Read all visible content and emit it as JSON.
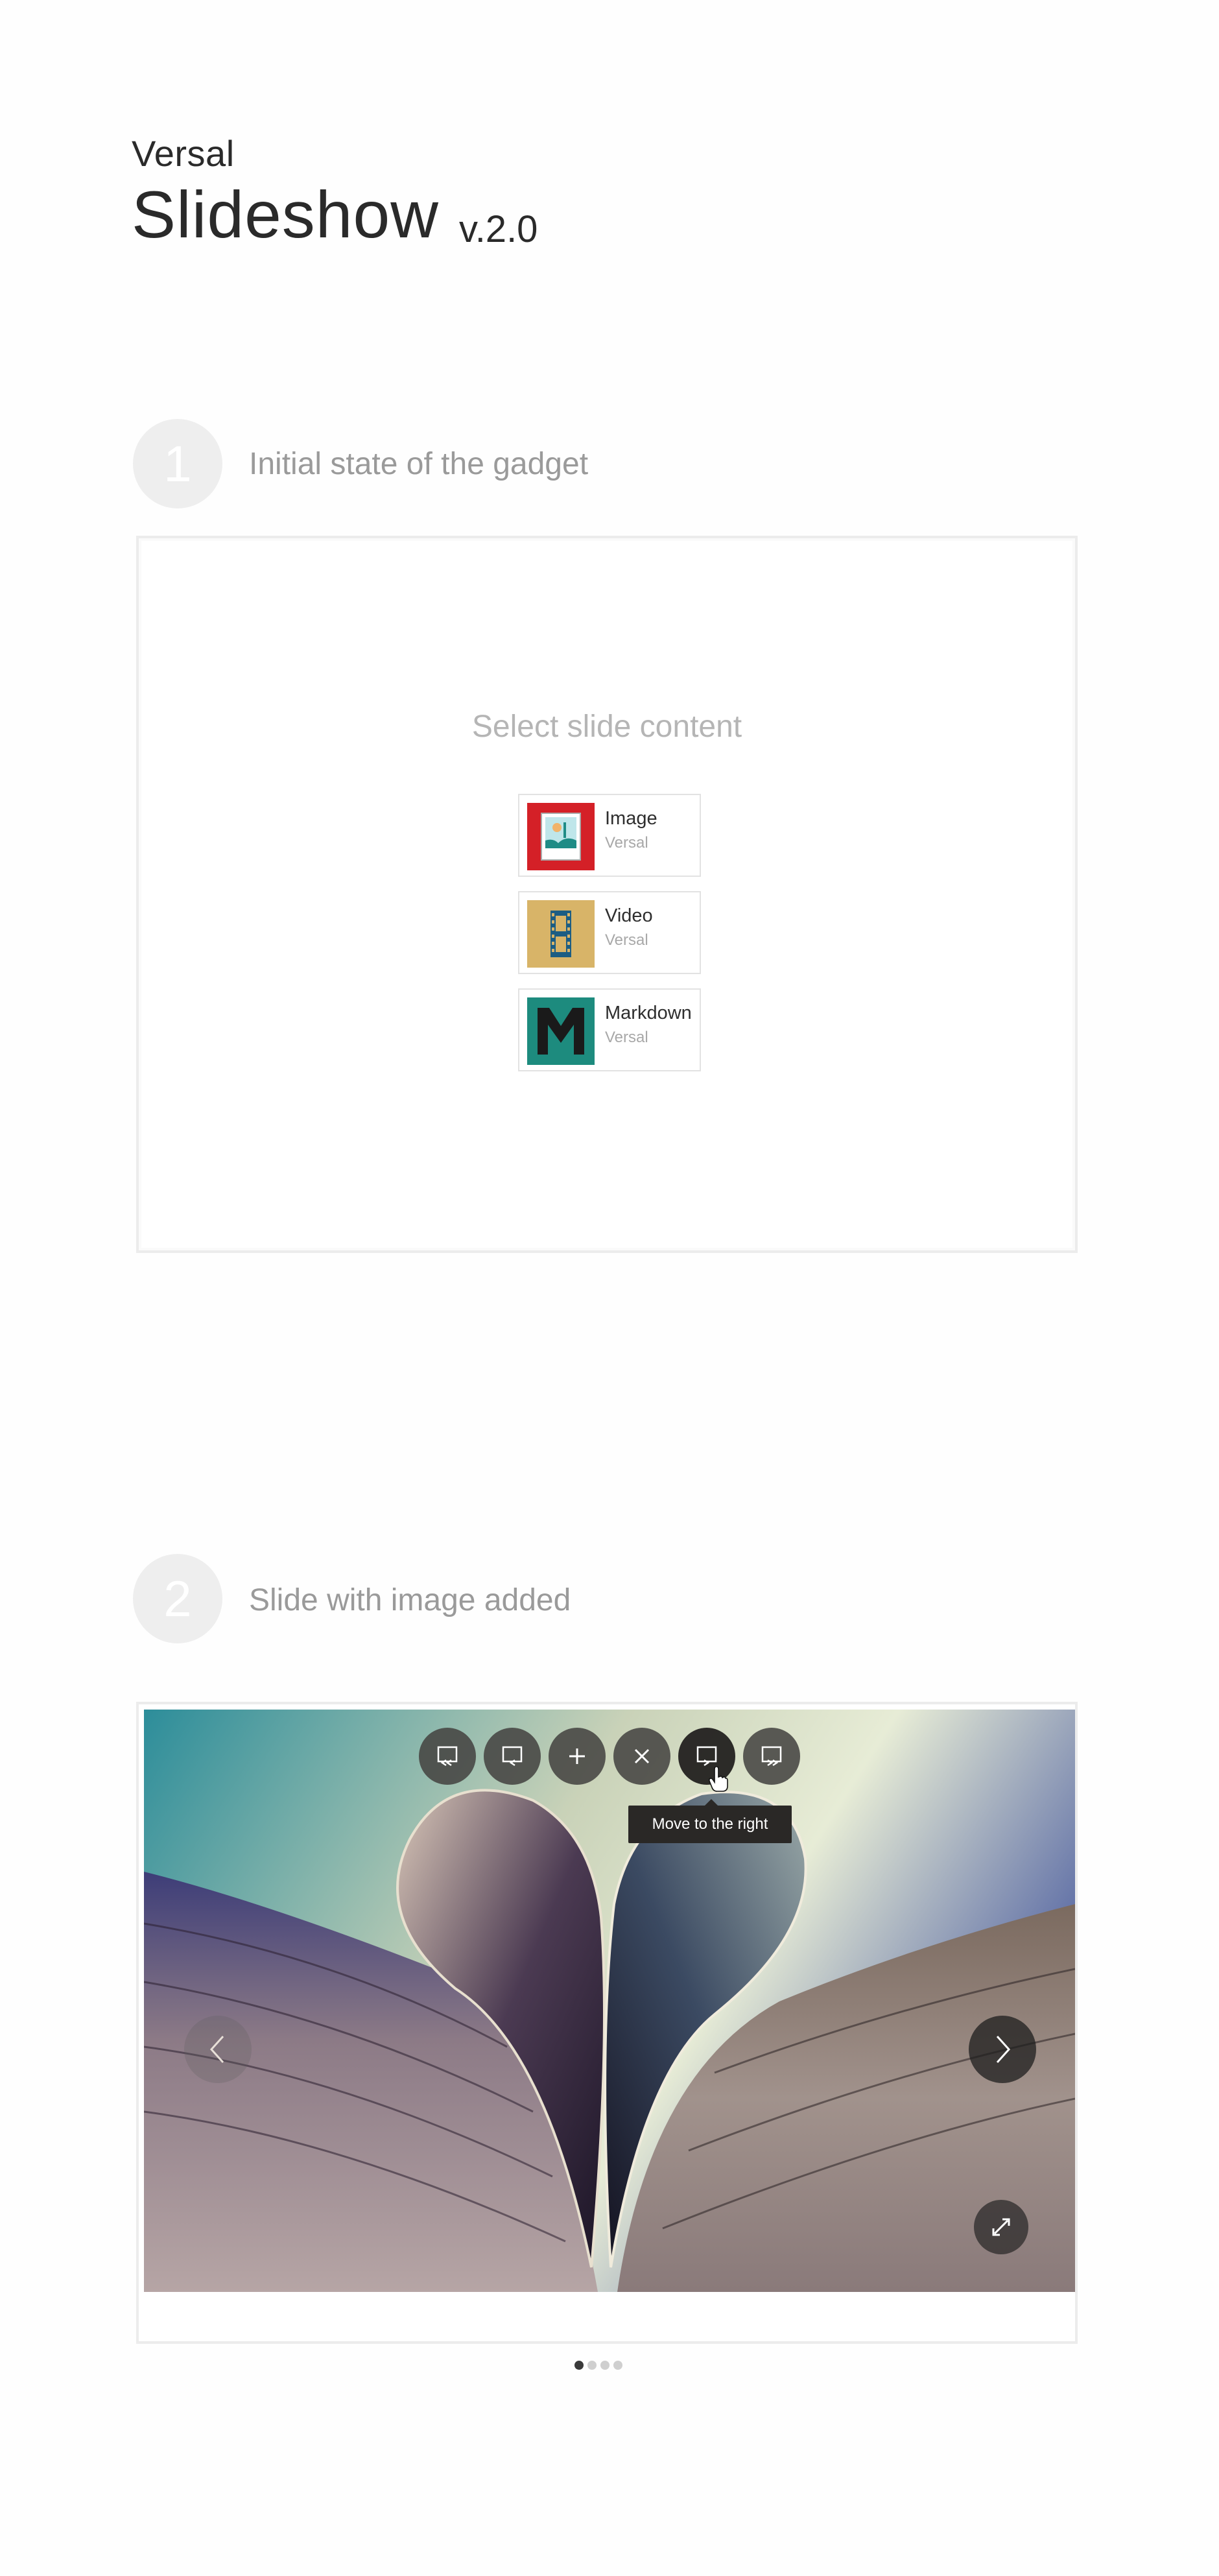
{
  "header": {
    "brand": "Versal",
    "title": "Slideshow",
    "version": "v.2.0"
  },
  "step1": {
    "number": "1",
    "label": "Initial state of the gadget",
    "select_title": "Select slide content",
    "options": [
      {
        "name": "Image",
        "vendor": "Versal",
        "icon": "image-icon",
        "color": "#d42027"
      },
      {
        "name": "Video",
        "vendor": "Versal",
        "icon": "film-icon",
        "color": "#d8b468"
      },
      {
        "name": "Markdown",
        "vendor": "Versal",
        "icon": "markdown-icon",
        "color": "#1d8b7e"
      }
    ]
  },
  "step2": {
    "number": "2",
    "label": "Slide with image added",
    "toolbar": [
      {
        "icon": "move-first-icon"
      },
      {
        "icon": "move-left-icon"
      },
      {
        "icon": "add-icon"
      },
      {
        "icon": "delete-icon"
      },
      {
        "icon": "move-right-icon"
      },
      {
        "icon": "move-last-icon"
      }
    ],
    "tooltip": "Move to the right",
    "slide_image": "heart-shaped book pages photo",
    "pagination": {
      "total": 4,
      "active": 1
    }
  }
}
